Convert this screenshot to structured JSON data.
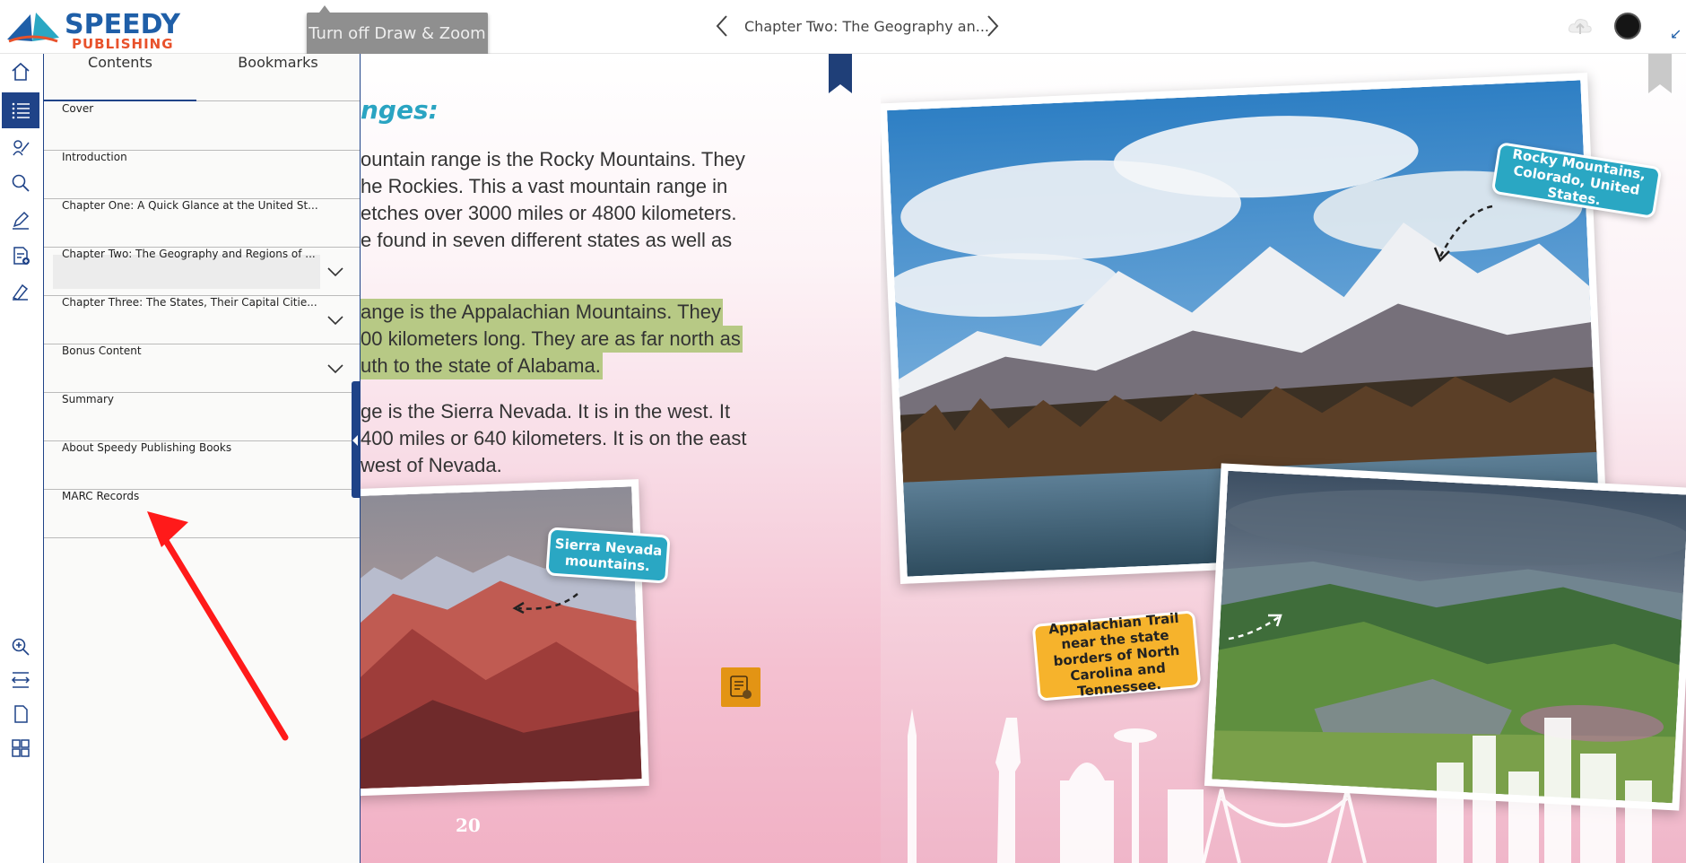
{
  "brand": {
    "name_top": "SPEEDY",
    "name_bottom": "PUBLISHING"
  },
  "tooltip": "Turn off Draw & Zoom",
  "header": {
    "chapter_title": "Chapter Two: The Geography an...",
    "prev_icon": "chevron-left-icon",
    "next_icon": "chevron-right-icon"
  },
  "rail": {
    "items": [
      {
        "name": "home-icon"
      },
      {
        "name": "contents-list-icon",
        "active": true
      },
      {
        "name": "draw-icon"
      },
      {
        "name": "search-icon"
      },
      {
        "name": "highlight-pen-icon"
      },
      {
        "name": "add-note-icon"
      },
      {
        "name": "eraser-icon"
      },
      {
        "name": "zoom-in-icon"
      },
      {
        "name": "fit-width-icon"
      },
      {
        "name": "single-page-icon"
      },
      {
        "name": "thumbnails-icon"
      }
    ]
  },
  "panel": {
    "tabs": [
      "Contents",
      "Bookmarks"
    ],
    "toc": [
      {
        "label": "Cover",
        "expandable": false
      },
      {
        "label": "Introduction",
        "expandable": false
      },
      {
        "label": "Chapter One: A Quick Glance at the United St...",
        "expandable": false
      },
      {
        "label": "Chapter Two: The Geography and Regions of ...",
        "expandable": true,
        "current": true
      },
      {
        "label": "Chapter Three: The States, Their Capital Citie...",
        "expandable": true
      },
      {
        "label": "Bonus Content",
        "expandable": true
      },
      {
        "label": "Summary",
        "expandable": false
      },
      {
        "label": "About Speedy Publishing Books",
        "expandable": false
      },
      {
        "label": "MARC Records",
        "expandable": false
      }
    ]
  },
  "book": {
    "heading_fragment": "nges:",
    "para1": [
      "ountain range is the Rocky Mountains. They",
      "he Rockies. This a vast mountain range in",
      "etches over 3000 miles or 4800 kilometers.",
      "e found in seven different states as well as"
    ],
    "para2": [
      "ange is the Appalachian Mountains. They",
      "00 kilometers long. They are as far north as",
      "uth to the state of Alabama."
    ],
    "para3": [
      "ge is the Sierra Nevada. It is in the west. It",
      "400 miles or 640 kilometers. It is on the east",
      " west of Nevada."
    ],
    "page_number": "20",
    "callouts": {
      "sierra": "Sierra Nevada mountains.",
      "rocky": "Rocky Mountains, Colorado, United States.",
      "appalachian": "Appalachian Trail near the state borders of North Carolina and Tennessee."
    }
  },
  "colors": {
    "accent": "#1f4388",
    "teal": "#2aa7c3",
    "highlight": "#b7c985",
    "annotation_arrow": "#ff1a1a"
  }
}
